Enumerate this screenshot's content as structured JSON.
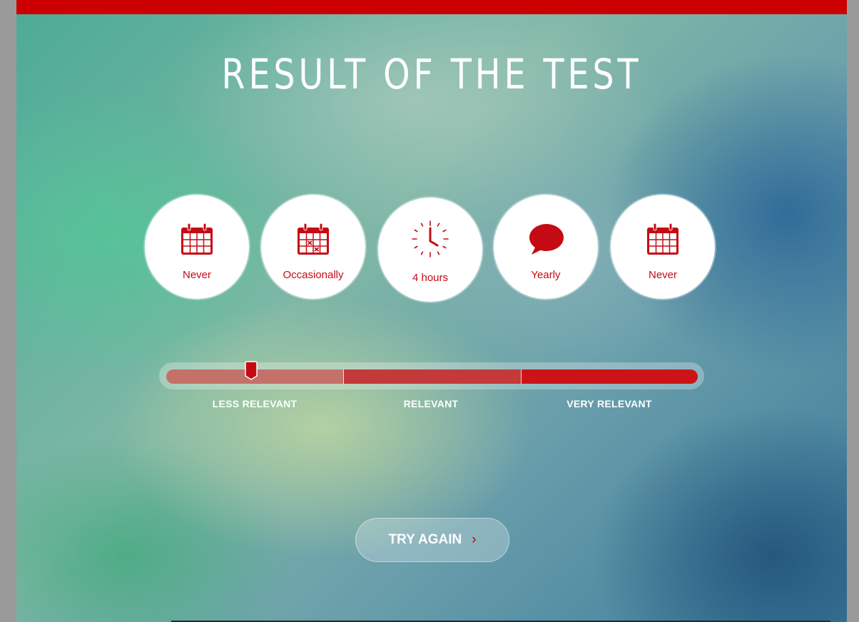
{
  "page": {
    "title": "RESULT OF THE TEST"
  },
  "answers": [
    {
      "icon": "calendar-icon",
      "label": "Never"
    },
    {
      "icon": "calendar-crossed-icon",
      "label": "Occasionally"
    },
    {
      "icon": "clock-icon",
      "label": "4 hours"
    },
    {
      "icon": "speech-bubble-icon",
      "label": "Yearly"
    },
    {
      "icon": "calendar-icon",
      "label": "Never"
    }
  ],
  "relevance_scale": {
    "bands": [
      "LESS RELEVANT",
      "RELEVANT",
      "VERY RELEVANT"
    ],
    "marker_fraction": 0.16
  },
  "actions": {
    "try_again_label": "TRY AGAIN",
    "try_again_arrow": "›"
  },
  "colors": {
    "accent": "#cc0000",
    "band_less": "#c4716a",
    "band_mid": "#c4393a",
    "band_very": "#cc1418"
  }
}
